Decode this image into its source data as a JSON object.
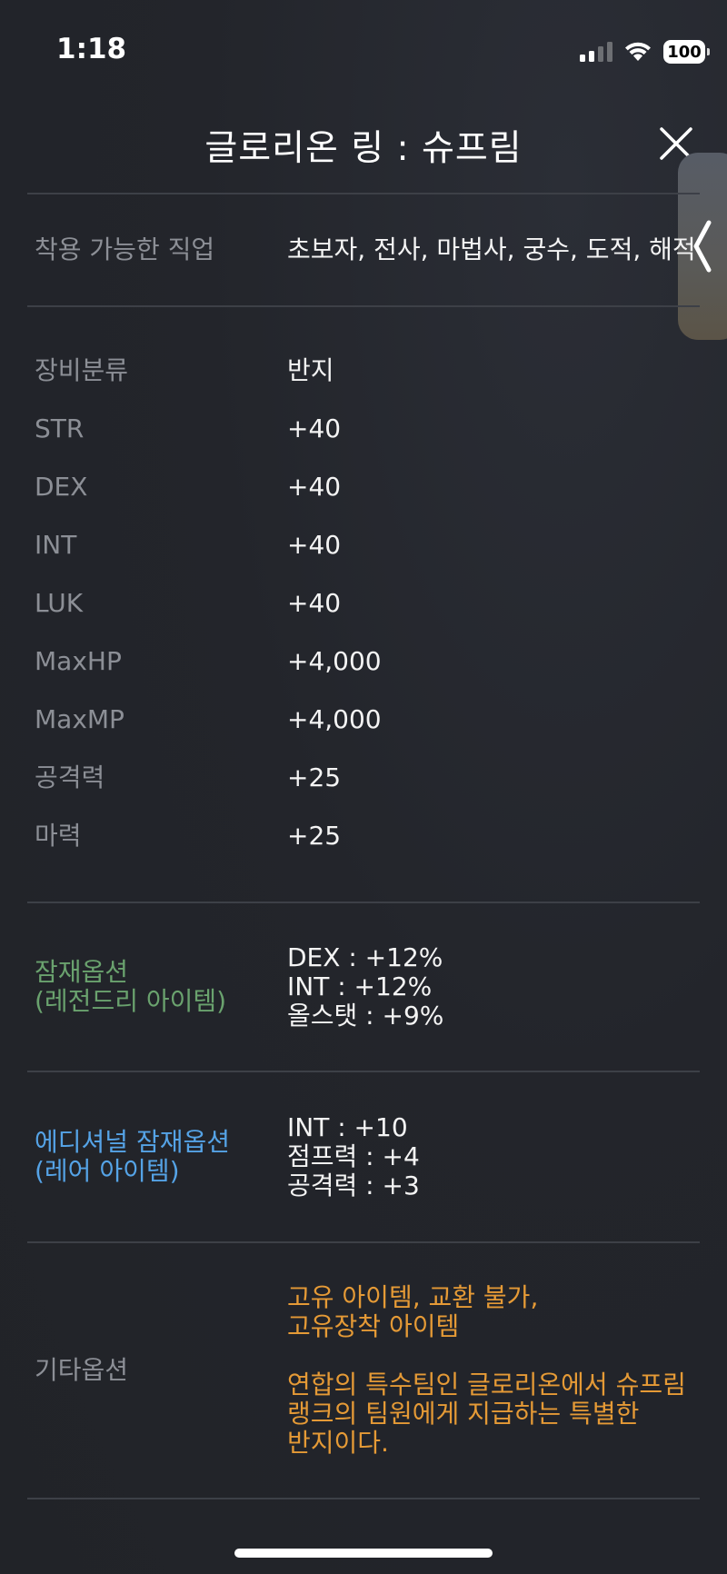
{
  "status_bar": {
    "time": "1:18",
    "battery": "100",
    "icons": [
      "cellular-signal-icon",
      "wifi-icon",
      "battery-icon"
    ]
  },
  "header": {
    "title": "글로리온 링 : 슈프림",
    "close_icon": "close-icon",
    "side_tab_icon": "chevron-left-icon"
  },
  "jobs": {
    "label": "착용 가능한 직업",
    "value": "초보자, 전사, 마법사, 궁수, 도적, 해적"
  },
  "stats": [
    {
      "label": "장비분류",
      "value": "반지"
    },
    {
      "label": "STR",
      "value": "+40"
    },
    {
      "label": "DEX",
      "value": "+40"
    },
    {
      "label": "INT",
      "value": "+40"
    },
    {
      "label": "LUK",
      "value": "+40"
    },
    {
      "label": "MaxHP",
      "value": "+4,000"
    },
    {
      "label": "MaxMP",
      "value": "+4,000"
    },
    {
      "label": "공격력",
      "value": "+25"
    },
    {
      "label": "마력",
      "value": "+25"
    }
  ],
  "potential": {
    "label_line1": "잠재옵션",
    "label_line2": "(레전드리 아이템)",
    "lines": [
      "DEX : +12%",
      "INT : +12%",
      "올스탯 : +9%"
    ]
  },
  "additional_potential": {
    "label_line1": "에디셔널 잠재옵션",
    "label_line2": "(레어 아이템)",
    "lines": [
      "INT : +10",
      "점프력 : +4",
      "공격력 : +3"
    ]
  },
  "etc": {
    "label": "기타옵션",
    "line1": "고유 아이템, 교환 불가,",
    "line2": "고유장착 아이템",
    "desc1": "연합의 특수팀인 글로리온에서 슈프림",
    "desc2": "랭크의 팀원에게 지급하는 특별한",
    "desc3": "반지이다."
  },
  "colors": {
    "background": "#22242a",
    "label": "#8c8f96",
    "potential": "#6aa26e",
    "additional": "#55a3e6",
    "etc": "#e59a36"
  }
}
